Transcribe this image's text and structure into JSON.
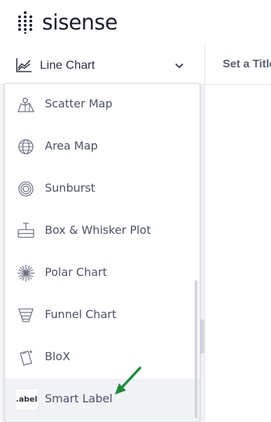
{
  "app": {
    "brand": "sisense"
  },
  "widget": {
    "type_selector_label": "Line Chart",
    "title_placeholder": "Set a Title"
  },
  "chart_types": [
    {
      "label": "Scatter Map",
      "icon": "scatter-map-icon"
    },
    {
      "label": "Area Map",
      "icon": "globe-icon"
    },
    {
      "label": "Sunburst",
      "icon": "sunburst-icon"
    },
    {
      "label": "Box & Whisker Plot",
      "icon": "box-whisker-icon"
    },
    {
      "label": "Polar Chart",
      "icon": "polar-chart-icon"
    },
    {
      "label": "Funnel Chart",
      "icon": "funnel-icon"
    },
    {
      "label": "BloX",
      "icon": "blox-icon"
    },
    {
      "label": "Smart Label",
      "icon": "label-icon",
      "badge": ".abel"
    }
  ],
  "colors": {
    "accent_arrow": "#1e8a3f",
    "text": "#4b5263",
    "selected_bg": "#f1f2f6"
  }
}
